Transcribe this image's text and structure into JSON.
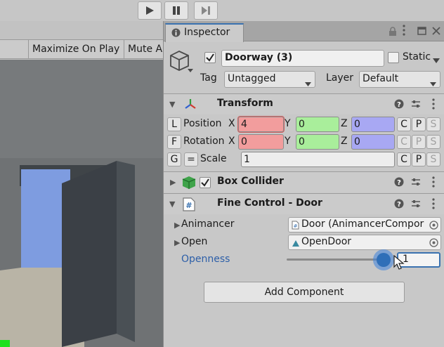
{
  "toolbar": {
    "play_icon": "play-icon",
    "pause_icon": "pause-icon",
    "step_icon": "step-icon"
  },
  "game_view": {
    "maximize_label": "Maximize On Play",
    "mute_label": "Mute A"
  },
  "inspector": {
    "tab_label": "Inspector",
    "object_name": "Doorway (3)",
    "static_label": "Static",
    "tag_label": "Tag",
    "tag_value": "Untagged",
    "layer_label": "Layer",
    "layer_value": "Default",
    "transform": {
      "title": "Transform",
      "position_label": "Position",
      "rotation_label": "Rotation",
      "scale_label": "Scale",
      "btn_l": "L",
      "btn_f": "F",
      "btn_g": "G",
      "btn_eq": "=",
      "axis_x": "X",
      "axis_y": "Y",
      "axis_z": "Z",
      "pos_x": "4",
      "pos_y": "0",
      "pos_z": "0",
      "rot_x": "0",
      "rot_y": "0",
      "rot_z": "0",
      "scale_value": "1",
      "c": "C",
      "p": "P",
      "s": "S"
    },
    "box_collider": {
      "title": "Box Collider"
    },
    "fine_control": {
      "title": "Fine Control - Door",
      "animancer_label": "Animancer",
      "animancer_value": "Door (AnimancerCompor",
      "open_label": "Open",
      "open_value": "OpenDoor",
      "openness_label": "Openness",
      "openness_value": "1",
      "openness_fraction": 1.0
    },
    "add_component_label": "Add Component"
  },
  "colors": {
    "x_field": "#f29d9d",
    "y_field": "#a9ee9b",
    "z_field": "#a8a8f3",
    "accent": "#3a72b0",
    "slider_knob": "#2f6fb8"
  }
}
